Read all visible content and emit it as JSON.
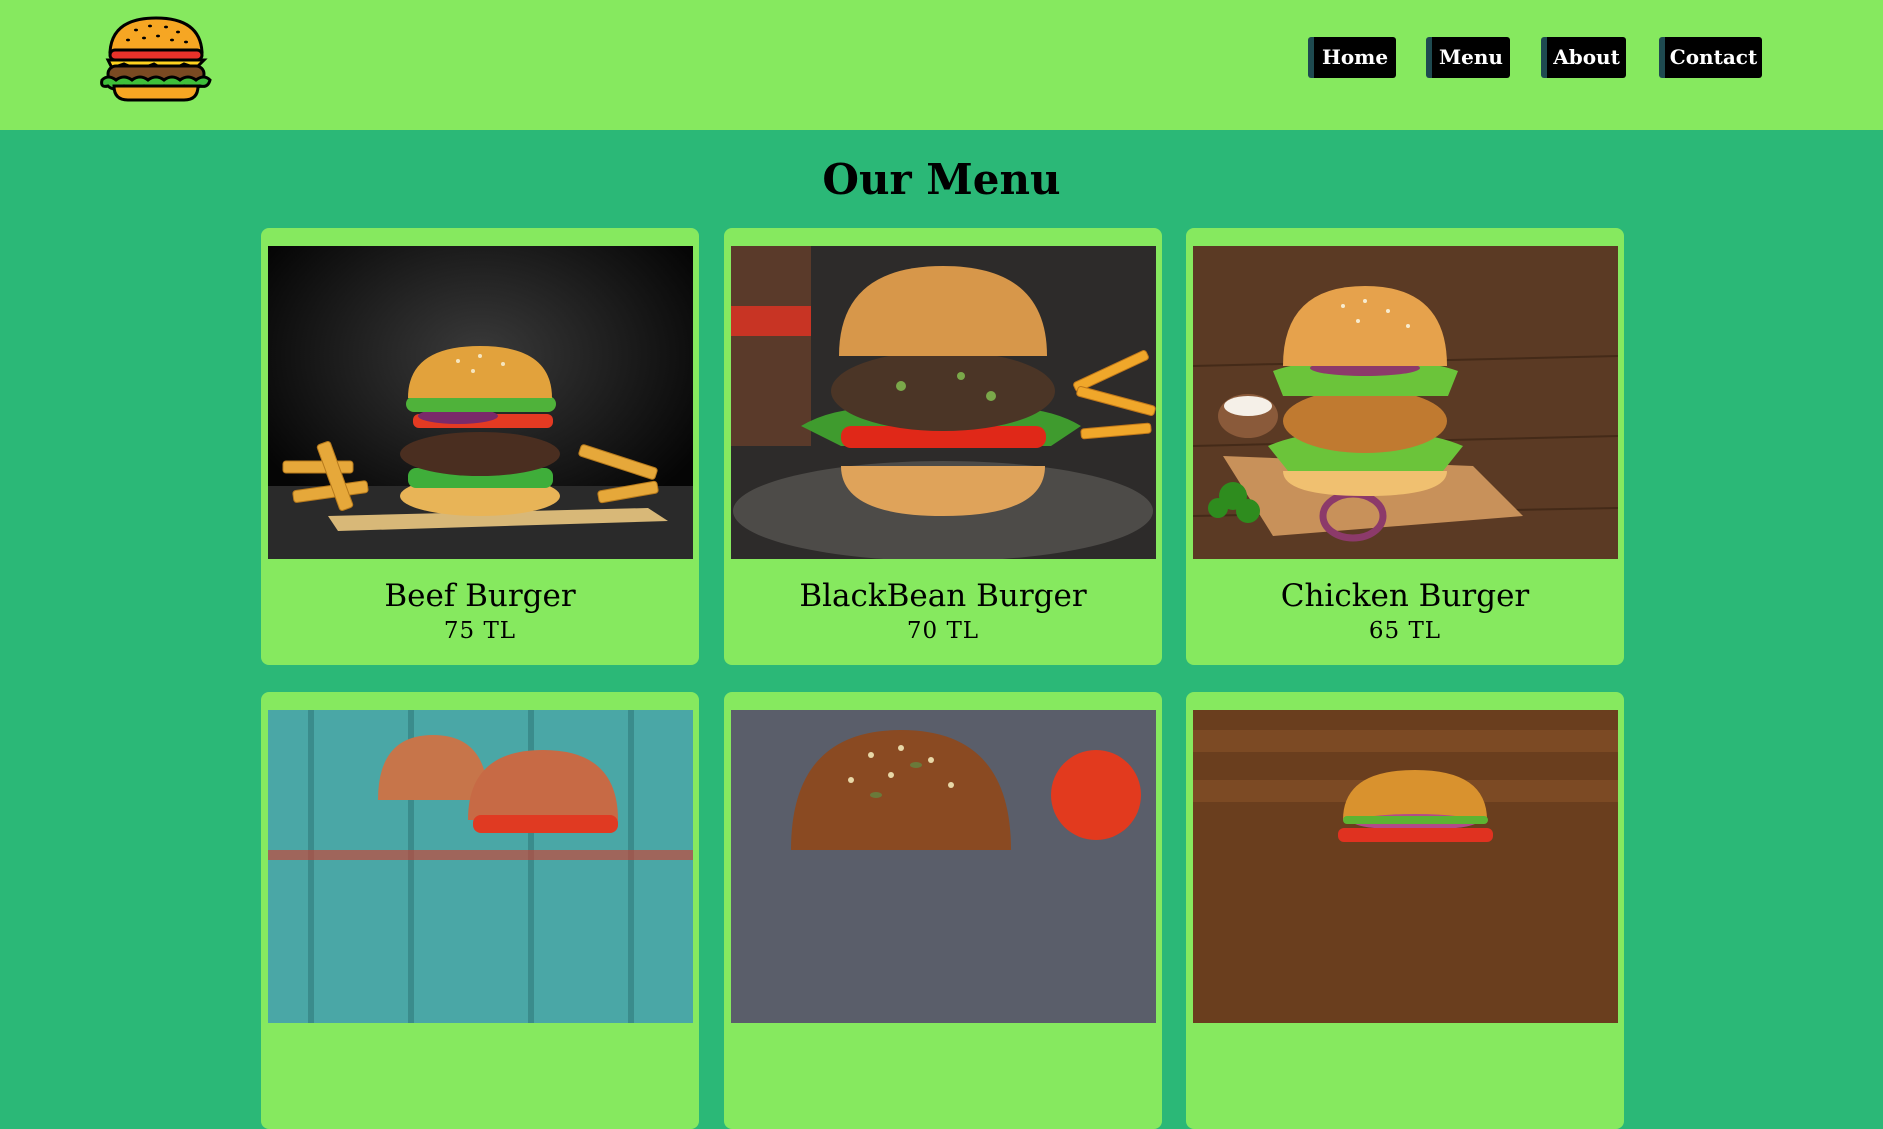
{
  "header": {
    "logo_icon": "burger-logo-icon",
    "nav": [
      {
        "label": "Home"
      },
      {
        "label": "Menu"
      },
      {
        "label": "About"
      },
      {
        "label": "Contact"
      }
    ]
  },
  "main": {
    "title": "Our Menu",
    "items": [
      {
        "name": "Beef Burger",
        "price": "75 TL",
        "image": "beef-burger-photo"
      },
      {
        "name": "BlackBean Burger",
        "price": "70 TL",
        "image": "blackbean-burger-photo"
      },
      {
        "name": "Chicken Burger",
        "price": "65 TL",
        "image": "chicken-burger-photo"
      },
      {
        "name": "",
        "price": "",
        "image": "double-burger-photo"
      },
      {
        "name": "",
        "price": "",
        "image": "seeded-bun-burger-photo"
      },
      {
        "name": "",
        "price": "",
        "image": "classic-burger-photo"
      }
    ]
  },
  "colors": {
    "header_bg": "#86e95f",
    "page_bg": "#2bb877",
    "card_bg": "#86e95f",
    "nav_bg": "#000000",
    "nav_text": "#ffffff"
  }
}
